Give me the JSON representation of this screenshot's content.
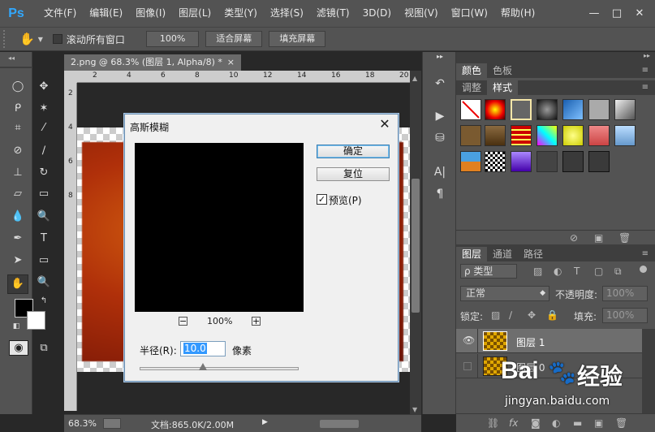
{
  "app": {
    "logo": "Ps"
  },
  "menu": [
    "文件(F)",
    "编辑(E)",
    "图像(I)",
    "图层(L)",
    "类型(Y)",
    "选择(S)",
    "滤镜(T)",
    "3D(D)",
    "视图(V)",
    "窗口(W)",
    "帮助(H)"
  ],
  "window_controls": {
    "minimize": "—",
    "restore": "□",
    "close": "✕"
  },
  "options_bar": {
    "scroll_all_label": "滚动所有窗口",
    "btn_100": "100%",
    "btn_fit": "适合屏幕",
    "btn_fill": "填充屏幕"
  },
  "document": {
    "tab_title": "2.png @ 68.3% (图层 1, Alpha/8) *",
    "tab_close": "×",
    "ruler_h": [
      "2",
      "4",
      "6",
      "8",
      "10",
      "12",
      "14",
      "16",
      "18",
      "20"
    ],
    "ruler_v": [
      "2",
      "4",
      "6",
      "8",
      "1\n0",
      "1\n2",
      "1\n4",
      "1\n6",
      "1\n8"
    ]
  },
  "status": {
    "zoom": "68.3%",
    "doc_info": "文档:865.0K/2.00M"
  },
  "dialog": {
    "title": "高斯模糊",
    "close": "✕",
    "ok": "确定",
    "reset": "复位",
    "preview_label": "预览(P)",
    "preview_checked": true,
    "zoom_minus": "−",
    "zoom_value": "100%",
    "zoom_plus": "+",
    "radius_label": "半径(R):",
    "radius_value": "10.0",
    "radius_unit": "像素",
    "slider_fraction": 0.4
  },
  "panels": {
    "top_tabs": [
      "颜色",
      "色板"
    ],
    "second_tabs": [
      "调整",
      "样式"
    ],
    "layers_tabs": [
      "图层",
      "通道",
      "路径"
    ],
    "kind_filter": "ρ 类型",
    "blend_mode": "正常",
    "opacity_label": "不透明度:",
    "opacity_value": "100%",
    "lock_label": "锁定:",
    "fill_label": "填充:",
    "fill_value": "100%",
    "layers": [
      {
        "name": "图层 1",
        "visible": true,
        "selected": true
      },
      {
        "name": "图层 0",
        "visible": false,
        "selected": false
      }
    ]
  },
  "watermark": {
    "brand": "Bai",
    "brand2": "经验",
    "url": "jingyan.baidu.com"
  },
  "colors": {
    "accent_blue": "#31a8ff",
    "panel": "#535353",
    "dialog": "#f0f0f0"
  }
}
